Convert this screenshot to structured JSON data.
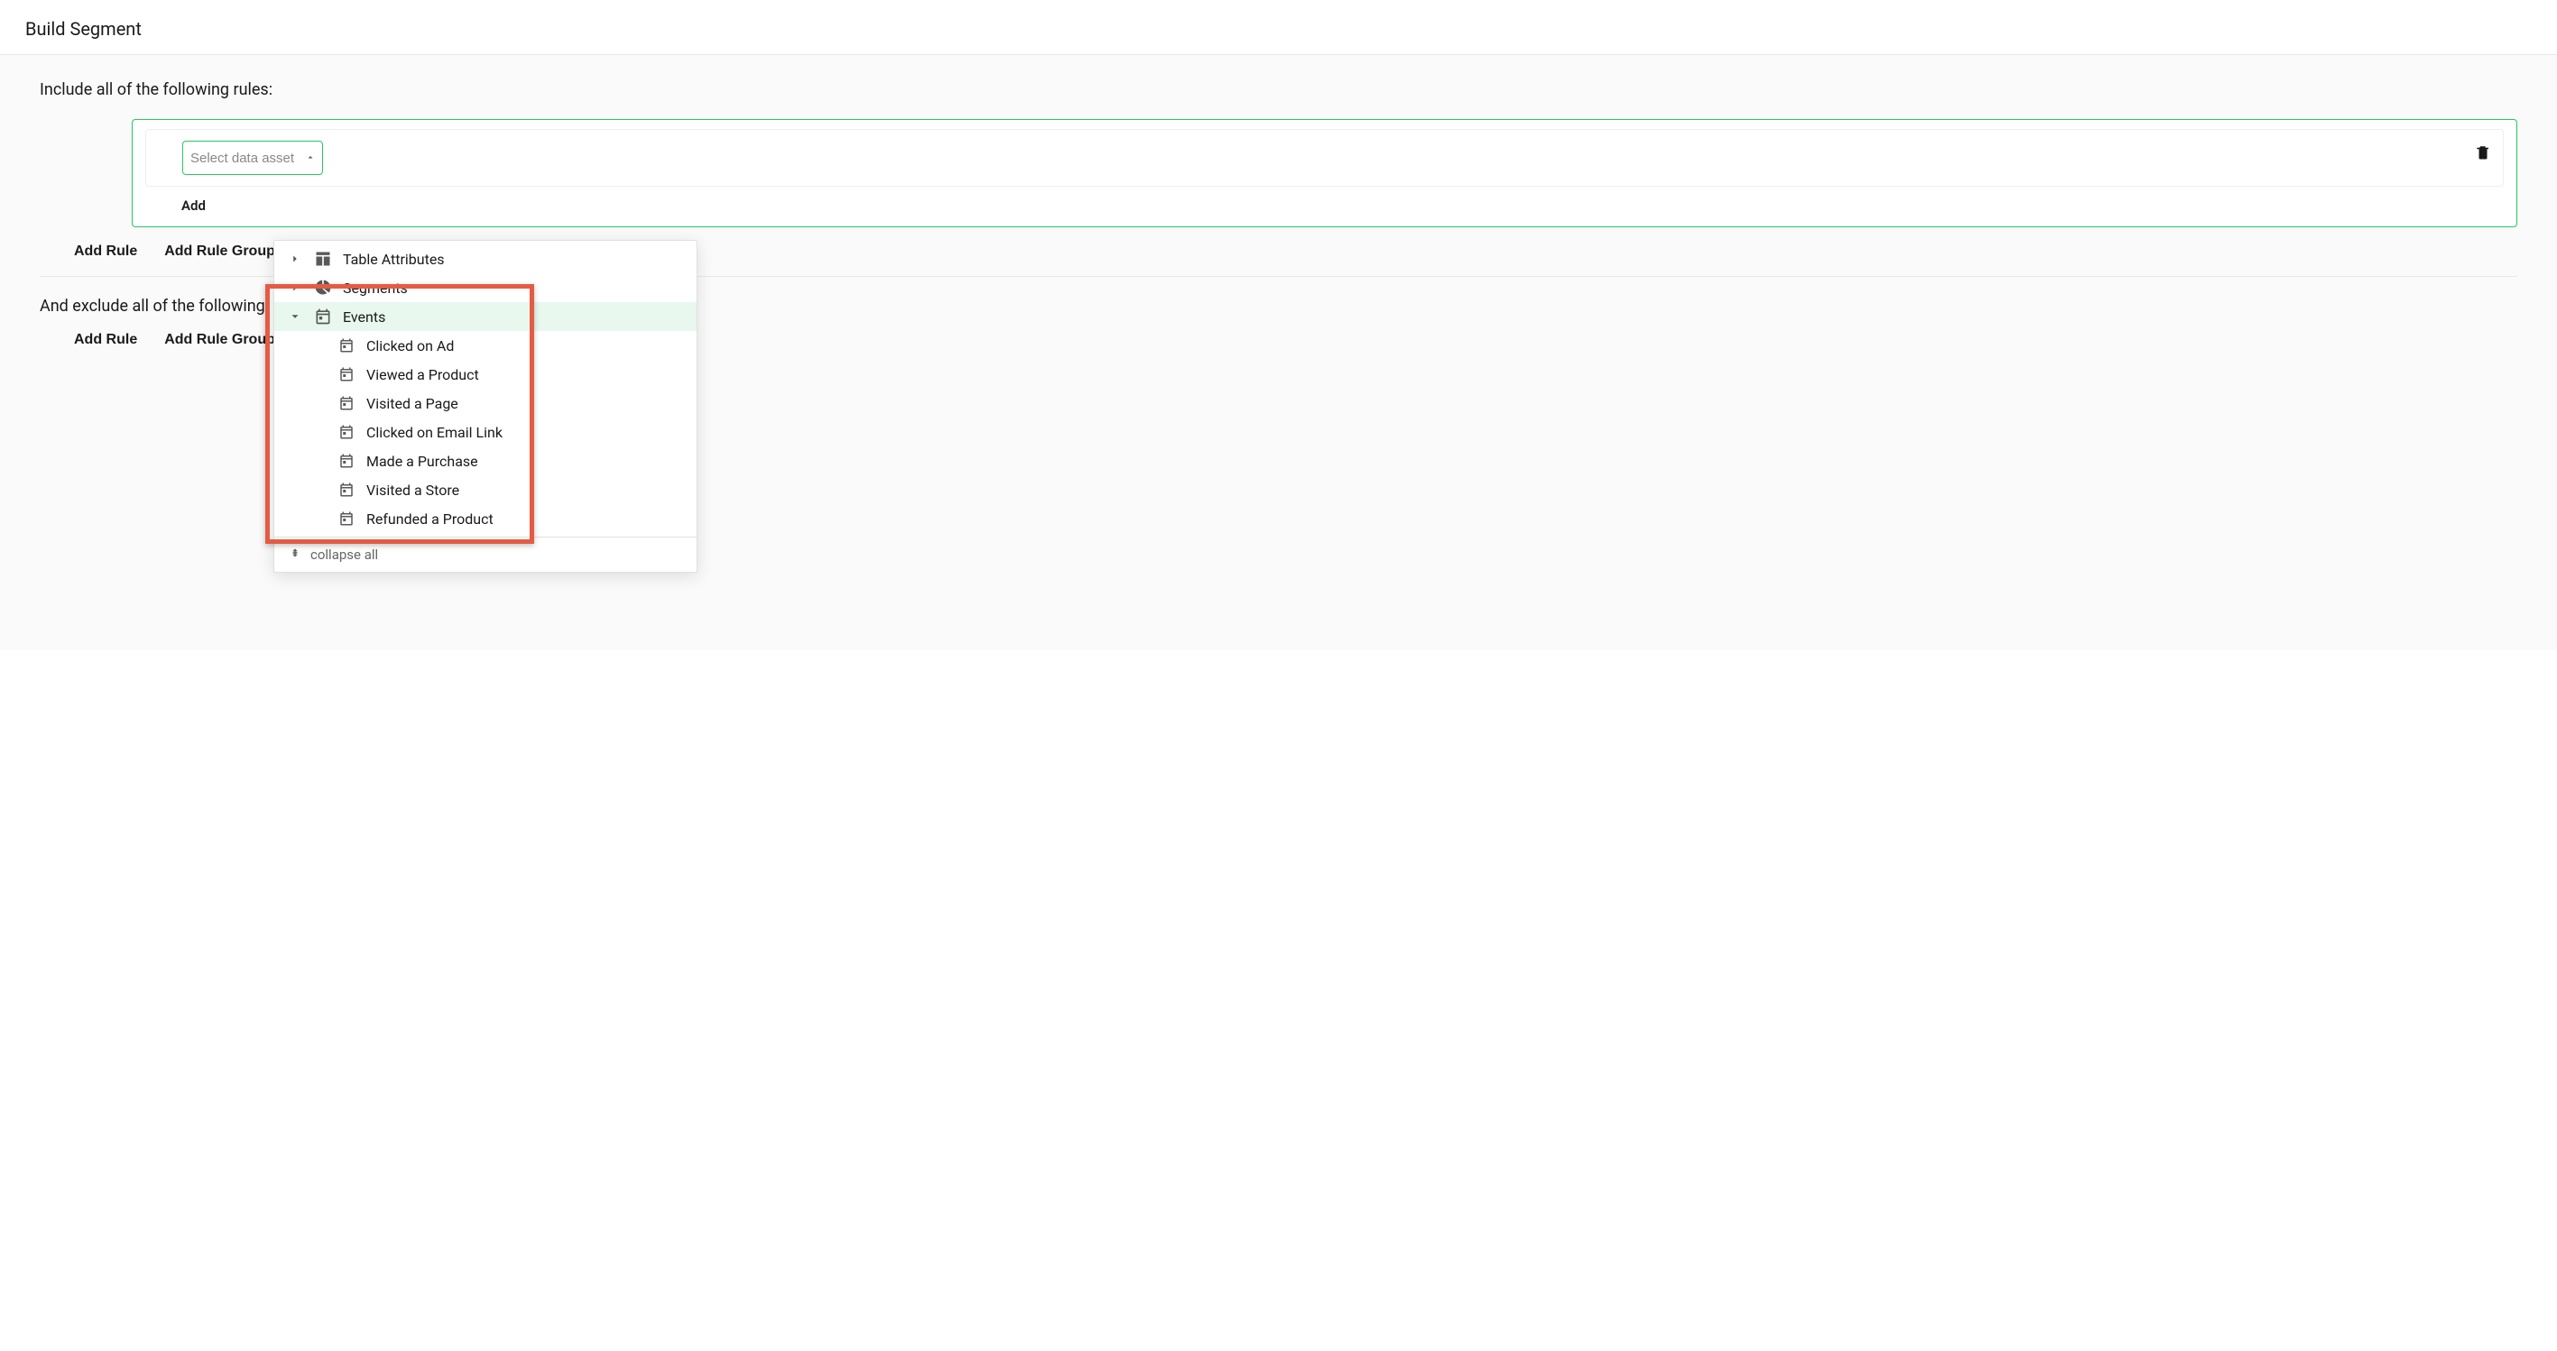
{
  "header": {
    "title": "Build Segment"
  },
  "include": {
    "label": "Include all of the following rules:",
    "select_placeholder": "Select data asset",
    "add_partial": "Add ",
    "buttons": {
      "add_rule": "Add Rule",
      "add_rule_group": "Add Rule Group"
    }
  },
  "exclude": {
    "label": "And exclude all of the following ",
    "buttons": {
      "add_rule": "Add Rule",
      "add_rule_group": "Add Rule Group"
    }
  },
  "dropdown": {
    "items": {
      "table_attributes": "Table Attributes",
      "segments": "Segments",
      "events": "Events"
    },
    "event_children": [
      "Clicked on Ad",
      "Viewed a Product",
      "Visited a Page",
      "Clicked on Email Link",
      "Made a Purchase",
      "Visited a Store",
      "Refunded a Product"
    ],
    "collapse_all": "collapse all"
  }
}
